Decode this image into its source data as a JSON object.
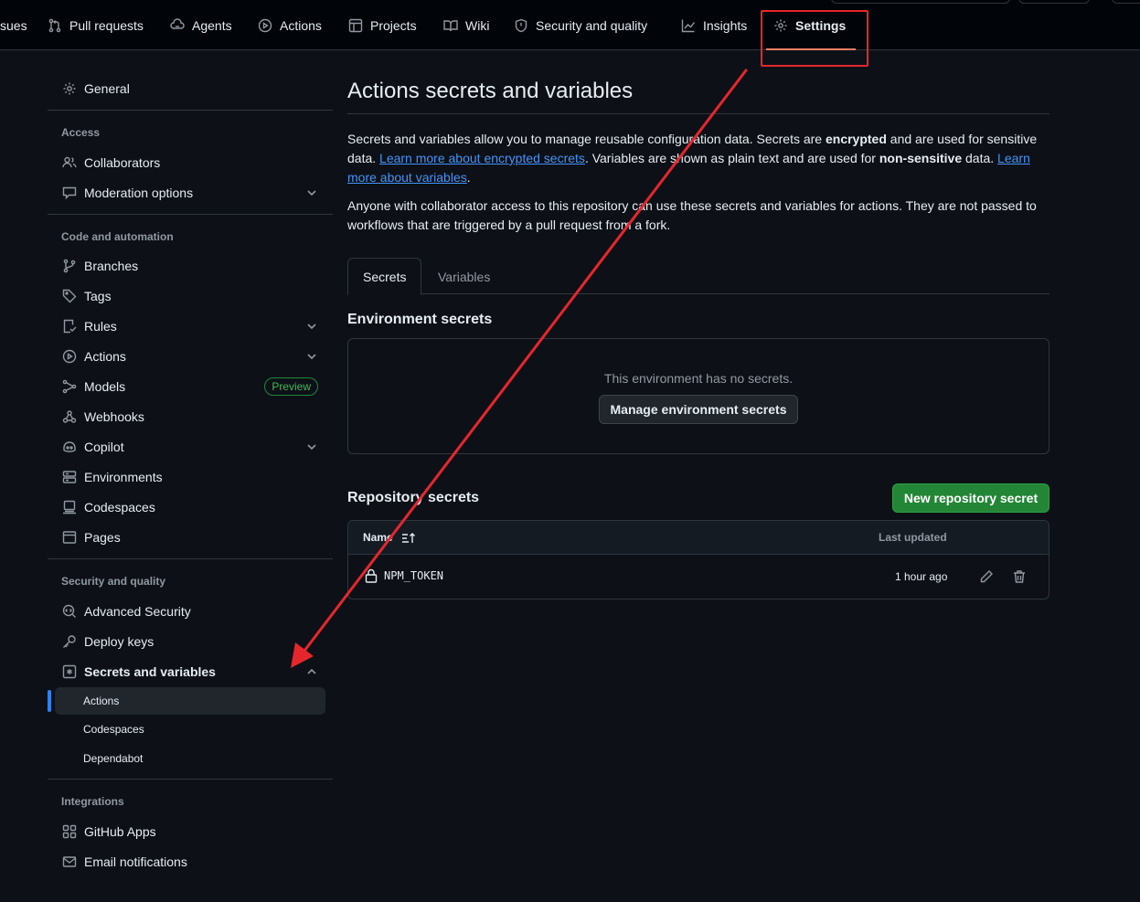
{
  "topnav": {
    "tabs": [
      {
        "label": "sues",
        "icon": "issues-icon"
      },
      {
        "label": "Pull requests",
        "icon": "pull-request-icon"
      },
      {
        "label": "Agents",
        "icon": "agents-icon"
      },
      {
        "label": "Actions",
        "icon": "play-icon"
      },
      {
        "label": "Projects",
        "icon": "table-icon"
      },
      {
        "label": "Wiki",
        "icon": "book-icon"
      },
      {
        "label": "Security and quality",
        "icon": "shield-icon"
      },
      {
        "label": "Insights",
        "icon": "graph-icon"
      },
      {
        "label": "Settings",
        "icon": "gear-icon"
      }
    ]
  },
  "sidebar": {
    "general": "General",
    "access_heading": "Access",
    "access": [
      "Collaborators",
      "Moderation options"
    ],
    "code_heading": "Code and automation",
    "code": [
      "Branches",
      "Tags",
      "Rules",
      "Actions",
      "Models",
      "Webhooks",
      "Copilot",
      "Environments",
      "Codespaces",
      "Pages"
    ],
    "models_badge": "Preview",
    "security_heading": "Security and quality",
    "security": [
      "Advanced Security",
      "Deploy keys",
      "Secrets and variables"
    ],
    "secrets_sub": [
      "Actions",
      "Codespaces",
      "Dependabot"
    ],
    "integrations_heading": "Integrations",
    "integrations": [
      "GitHub Apps",
      "Email notifications"
    ]
  },
  "main": {
    "title": "Actions secrets and variables",
    "p1_a": "Secrets and variables allow you to manage reusable configuration data. Secrets are ",
    "p1_b": "encrypted",
    "p1_c": " and are used for sensitive data. ",
    "p1_link1": "Learn more about encrypted secrets",
    "p1_d": ". Variables are shown as plain text and are used for ",
    "p1_e": "non-sensitive",
    "p1_f": " data. ",
    "p1_link2": "Learn more about variables",
    "p1_g": ".",
    "p2": "Anyone with collaborator access to this repository can use these secrets and variables for actions. They are not passed to workflows that are triggered by a pull request from a fork.",
    "tabs": [
      "Secrets",
      "Variables"
    ],
    "env_heading": "Environment secrets",
    "env_empty": "This environment has no secrets.",
    "env_button": "Manage environment secrets",
    "repo_heading": "Repository secrets",
    "repo_button": "New repository secret",
    "table": {
      "col_name": "Name",
      "col_updated": "Last updated",
      "rows": [
        {
          "name": "NPM_TOKEN",
          "updated": "1 hour ago"
        }
      ]
    }
  },
  "colors": {
    "accent_link": "#4493f8",
    "annotation_red": "#e5272d",
    "green_button": "#238636",
    "active_tab_underline": "#f78166"
  }
}
